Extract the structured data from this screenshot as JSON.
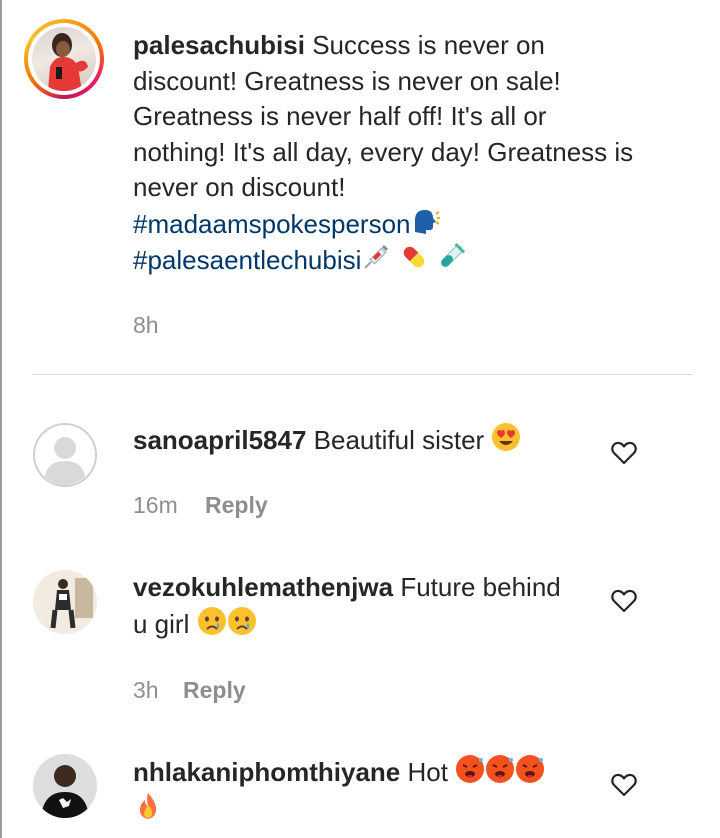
{
  "post": {
    "username": "palesachubisi",
    "caption": "Success is never on discount! Greatness is never on sale! Greatness is never half off! It's all or nothing! It's all day, every day! Greatness is never on discount!",
    "caption_lines": [
      "discount! Greatness is never on sale!",
      "Greatness is never half off! It's all or",
      "nothing! It's all day, every day! Greatness is",
      "never on discount!"
    ],
    "caption_first": "Success is never on",
    "hashtag1": "#madaamspokesperson",
    "hashtag2": "#palesaentlechubisi",
    "time": "8h"
  },
  "comments": [
    {
      "username": "sanoapril5847",
      "text": "Beautiful sister",
      "time": "16m",
      "reply_label": "Reply"
    },
    {
      "username": "vezokuhlemathenjwa",
      "text": "Future behind",
      "text2": "u girl",
      "time": "3h",
      "reply_label": "Reply"
    },
    {
      "username": "nhlakaniphomthiyane",
      "text": "Hot"
    }
  ],
  "icons": {
    "heart": "heart-outline-icon",
    "speaking_head": "speaking-head-emoji",
    "syringe": "syringe-emoji",
    "pill": "pill-emoji",
    "test_tube": "test-tube-emoji",
    "heart_eyes": "heart-eyes-emoji",
    "crying": "crying-face-emoji",
    "hot_face": "hot-face-emoji",
    "fire": "fire-emoji"
  },
  "colors": {
    "hashtag": "#00376b",
    "meta": "#8e8e8e",
    "text": "#262626"
  }
}
